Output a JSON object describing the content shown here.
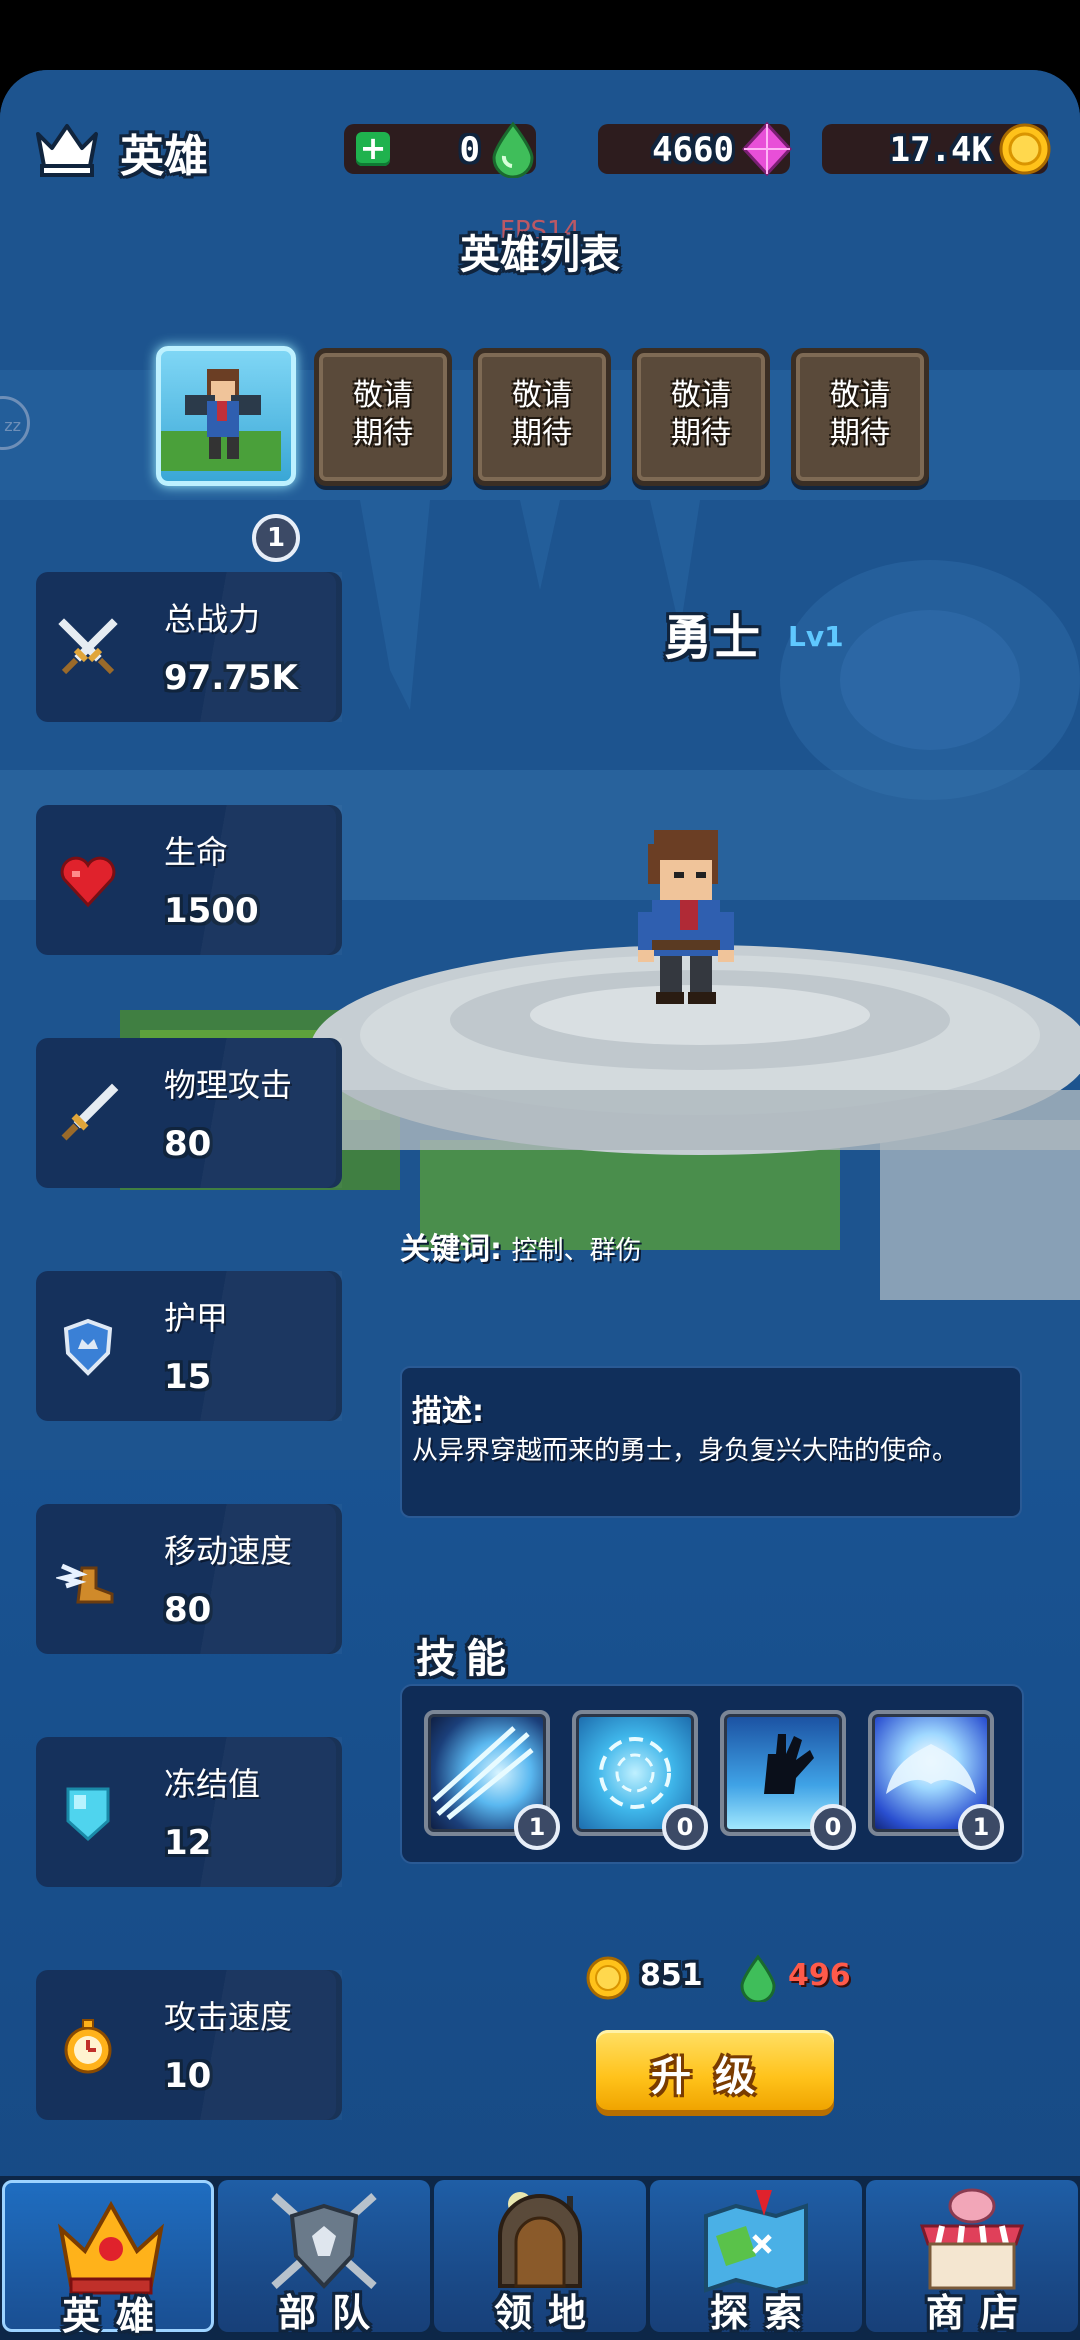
{
  "header": {
    "title": "英雄",
    "crown_icon": "crown-icon"
  },
  "resources": [
    {
      "name": "energy",
      "value": "0",
      "icon": "green-drop-icon",
      "has_plus": true
    },
    {
      "name": "gems",
      "value": "4660",
      "icon": "pink-gem-icon"
    },
    {
      "name": "gold",
      "value": "17.4K",
      "icon": "gold-coin-icon"
    }
  ],
  "fps_overlay": "FPS14",
  "hero_list": {
    "title": "英雄列表",
    "active_badge": "1",
    "locked_slots": [
      "敬请\n期待",
      "敬请\n期待",
      "敬请\n期待",
      "敬请\n期待"
    ]
  },
  "hero": {
    "name": "勇士",
    "level": "Lv1"
  },
  "stats": [
    {
      "label": "总战力",
      "value": "97.75K",
      "icon": "crossed-swords-icon"
    },
    {
      "label": "生命",
      "value": "1500",
      "icon": "heart-icon"
    },
    {
      "label": "物理攻击",
      "value": "80",
      "icon": "sword-icon"
    },
    {
      "label": "护甲",
      "value": "15",
      "icon": "shield-icon"
    },
    {
      "label": "移动速度",
      "value": "80",
      "icon": "winged-boot-icon"
    },
    {
      "label": "冻结值",
      "value": "12",
      "icon": "ice-shield-icon"
    },
    {
      "label": "攻击速度",
      "value": "10",
      "icon": "stopwatch-icon"
    }
  ],
  "keywords": {
    "label": "关键词:",
    "value": "控制、群伤"
  },
  "description": {
    "label": "描述:",
    "text": "从异界穿越而来的勇士，身负复兴大陆的使命。"
  },
  "skills": {
    "title": "技能",
    "items": [
      {
        "icon": "lightning-slash-icon",
        "level": "1"
      },
      {
        "icon": "ice-vortex-icon",
        "level": "0"
      },
      {
        "icon": "dark-hand-icon",
        "level": "0"
      },
      {
        "icon": "ice-phoenix-icon",
        "level": "1"
      }
    ]
  },
  "upgrade_cost": {
    "gold": "851",
    "energy": "496"
  },
  "upgrade_button": "升级",
  "nav": [
    {
      "label": "英雄",
      "icon": "crown-tab-icon",
      "active": true
    },
    {
      "label": "部队",
      "icon": "shield-swords-tab-icon",
      "active": false
    },
    {
      "label": "领地",
      "icon": "gate-tab-icon",
      "active": false
    },
    {
      "label": "探索",
      "icon": "map-tab-icon",
      "active": false
    },
    {
      "label": "商店",
      "icon": "shop-tab-icon",
      "active": false
    }
  ],
  "colors": {
    "bg": "#1b5596",
    "card": "#15315c",
    "accent_gold": "#ffc21a",
    "level_blue": "#5fc8ff",
    "energy_red": "#ff5a4a"
  }
}
